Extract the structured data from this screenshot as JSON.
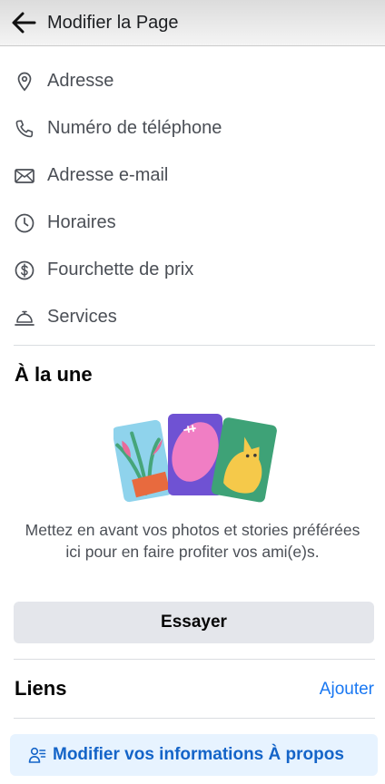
{
  "header": {
    "title": "Modifier la Page",
    "back_icon": "arrow-left-icon"
  },
  "info_rows": [
    {
      "label": "Adresse",
      "icon": "location-pin-icon"
    },
    {
      "label": "Numéro de téléphone",
      "icon": "phone-icon"
    },
    {
      "label": "Adresse e-mail",
      "icon": "envelope-icon"
    },
    {
      "label": "Horaires",
      "icon": "clock-icon"
    },
    {
      "label": "Fourchette de prix",
      "icon": "dollar-icon"
    },
    {
      "label": "Services",
      "icon": "service-bell-icon"
    }
  ],
  "featured": {
    "title": "À la une",
    "description": "Mettez en avant vos photos et stories préférées ici pour en faire profiter vos ami(e)s.",
    "button": "Essayer"
  },
  "links": {
    "title": "Liens",
    "add": "Ajouter"
  },
  "about_button": {
    "label": "Modifier vos informations À propos",
    "icon": "person-list-icon"
  },
  "colors": {
    "accent": "#1877f2",
    "button_bg": "#e4e6eb",
    "about_bg": "#e7f3ff"
  }
}
